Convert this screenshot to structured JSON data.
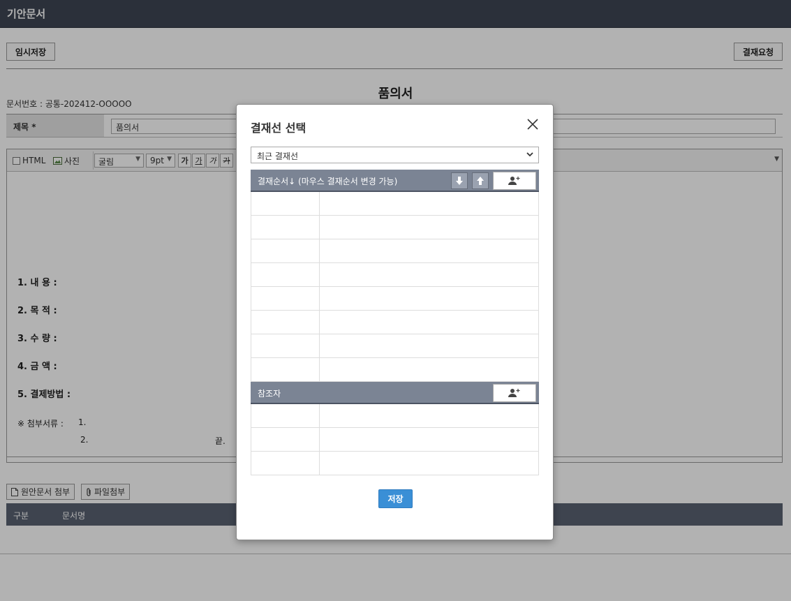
{
  "app": {
    "title": "기안문서"
  },
  "actions": {
    "temp_save": "임시저장",
    "request_approval": "결재요청"
  },
  "document": {
    "title": "품의서",
    "number_label": "문서번호 : 공통-202412-OOOOO",
    "subject_label": "제목 *",
    "subject_value": "품의서"
  },
  "editor": {
    "html_label": "HTML",
    "photo_label": "사진",
    "font_value": "굴림",
    "size_value": "9pt",
    "bold_label": "가",
    "underline_label": "가",
    "italic_label": "가",
    "strike_label": "가",
    "lines": [
      "1. 내      용 :",
      "2. 목      적 :",
      "3. 수      량 :",
      "4. 금      액 :",
      "5. 결제방법 :"
    ],
    "attach_label": "※ 첨부서류 :",
    "attach_1": "1.",
    "attach_2": "2.",
    "end_mark": "끝."
  },
  "attachments": {
    "original_doc_button": "원안문서 첨부",
    "file_button": "파일첨부",
    "col_type": "구분",
    "col_name": "문서명"
  },
  "modal": {
    "title": "결재선 선택",
    "select_value": "최근 결재선",
    "approval_header": "결재순서↓ (마우스 결재순서 변경 가능)",
    "reference_header": "참조자",
    "save_button": "저장",
    "icons": [
      "close-icon",
      "arrow-down-icon",
      "arrow-up-icon",
      "add-person-icon"
    ]
  },
  "colors": {
    "topbar": "#3e4654",
    "modal_header": "#7b8494",
    "save_button": "#3a8fd6"
  }
}
